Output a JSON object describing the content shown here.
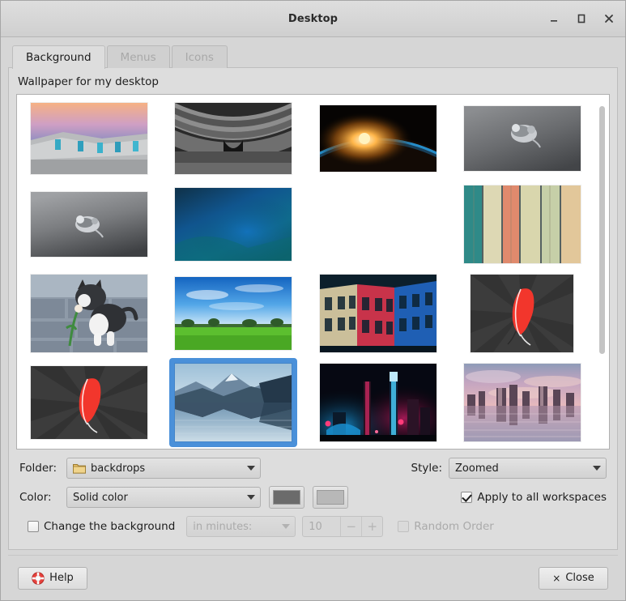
{
  "window": {
    "title": "Desktop",
    "buttons": {
      "minimize": "minimize",
      "maximize": "maximize",
      "close": "close"
    }
  },
  "tabs": [
    {
      "label": "Background",
      "active": true,
      "enabled": true
    },
    {
      "label": "Menus",
      "active": false,
      "enabled": false
    },
    {
      "label": "Icons",
      "active": false,
      "enabled": false
    }
  ],
  "background_tab": {
    "section_label": "Wallpaper for my desktop",
    "wallpapers": [
      {
        "name": "concrete-building-sunset",
        "selected": false,
        "empty": false
      },
      {
        "name": "open-book-grayscale",
        "selected": false,
        "empty": false
      },
      {
        "name": "earth-sunrise-from-space",
        "selected": false,
        "empty": false
      },
      {
        "name": "chrome-xfce-mouse-gray",
        "selected": false,
        "empty": false
      },
      {
        "name": "chrome-mouse-light-gray",
        "selected": false,
        "empty": false
      },
      {
        "name": "blue-teal-gradient",
        "selected": false,
        "empty": false
      },
      {
        "name": "empty-slot",
        "selected": false,
        "empty": true
      },
      {
        "name": "painted-wood-planks",
        "selected": false,
        "empty": false
      },
      {
        "name": "kitten-with-flower",
        "selected": false,
        "empty": false
      },
      {
        "name": "green-field-blue-sky",
        "selected": false,
        "empty": false
      },
      {
        "name": "lit-building-red-blue",
        "selected": false,
        "empty": false
      },
      {
        "name": "red-feather-dark-gray",
        "selected": false,
        "empty": false
      },
      {
        "name": "red-feather-dark-gray-2",
        "selected": false,
        "empty": false
      },
      {
        "name": "mountain-lake-reflection",
        "selected": true,
        "empty": false
      },
      {
        "name": "neon-night-city",
        "selected": false,
        "empty": false
      },
      {
        "name": "pink-sunset-skyline",
        "selected": false,
        "empty": false
      }
    ],
    "controls": {
      "folder_label": "Folder:",
      "folder_value": "backdrops",
      "style_label": "Style:",
      "style_value": "Zoomed",
      "color_label": "Color:",
      "color_value": "Solid color",
      "color_swatch_1": "#6b6b6b",
      "color_swatch_2": "#b8b8b8",
      "apply_all_workspaces_label": "Apply to all workspaces",
      "apply_all_workspaces_checked": true,
      "change_background_label": "Change the background",
      "change_background_checked": false,
      "interval_value": "in minutes:",
      "interval_number": "10",
      "spin_down": "−",
      "spin_up": "+",
      "random_order_label": "Random Order",
      "random_order_checked": false
    }
  },
  "footer": {
    "help_label": "Help",
    "close_label": "Close",
    "close_glyph": "×"
  },
  "scrollbar": {
    "name": "vertical-scrollbar"
  },
  "colors": {
    "selection": "#4a90d9",
    "window_bg": "#d6d6d6",
    "panel_bg": "#dddddd",
    "iconview_bg": "#ffffff"
  }
}
